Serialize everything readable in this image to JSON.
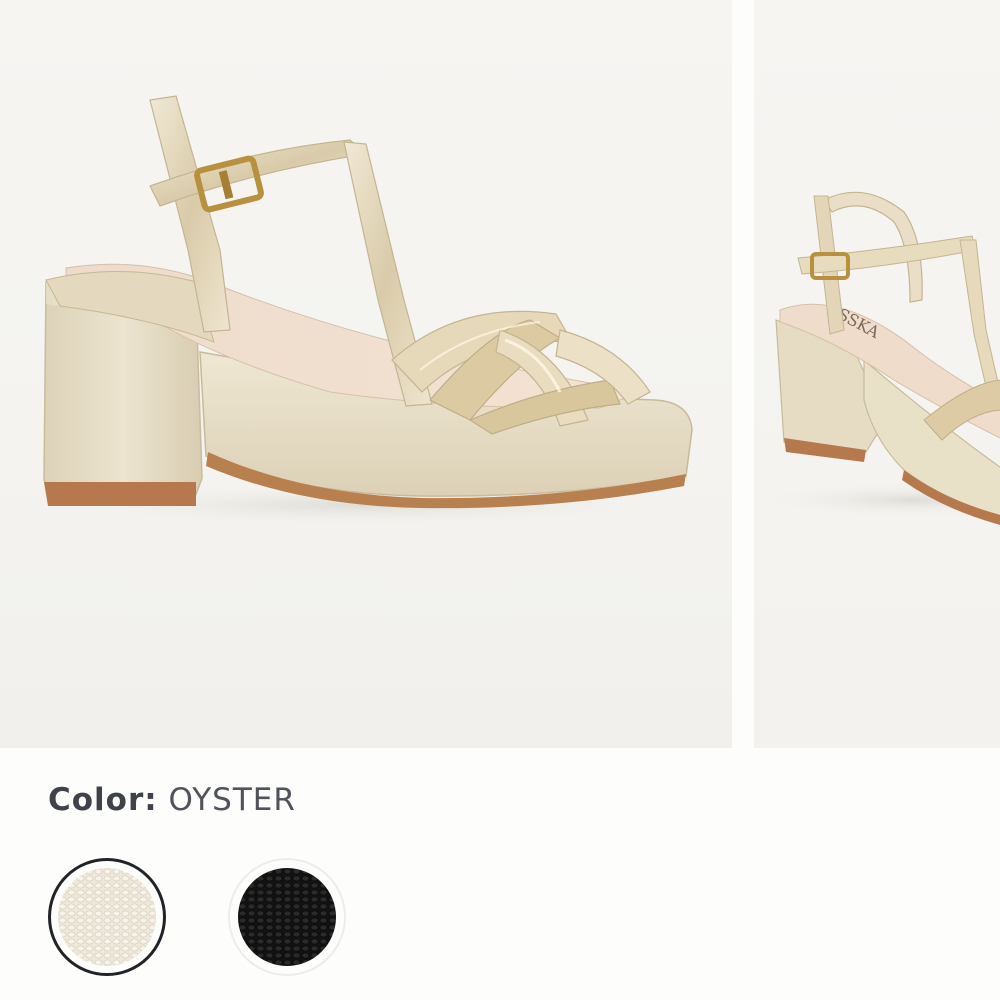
{
  "product_gallery": {
    "slides": [
      {
        "image": "Platform sandal in metallic lizard-embossed leather, side view"
      },
      {
        "image": "Platform sandal, three-quarter view"
      }
    ],
    "insole_brand_text": "ESSKA"
  },
  "color_selector": {
    "label": "Color:",
    "selected_value": "OYSTER",
    "swatches": [
      {
        "name": "OYSTER",
        "color": "#ece6d8",
        "selected": true
      },
      {
        "name": "BLACK",
        "color": "#1b1b1b",
        "selected": false
      }
    ]
  },
  "colors": {
    "page_background": "#fdfdfb",
    "label_text": "#4a4d55",
    "selected_ring": "#222327",
    "shoe_metallic": "#e6dcc4",
    "sole_tan": "#b5794d",
    "buckle_gold": "#b8913f"
  }
}
